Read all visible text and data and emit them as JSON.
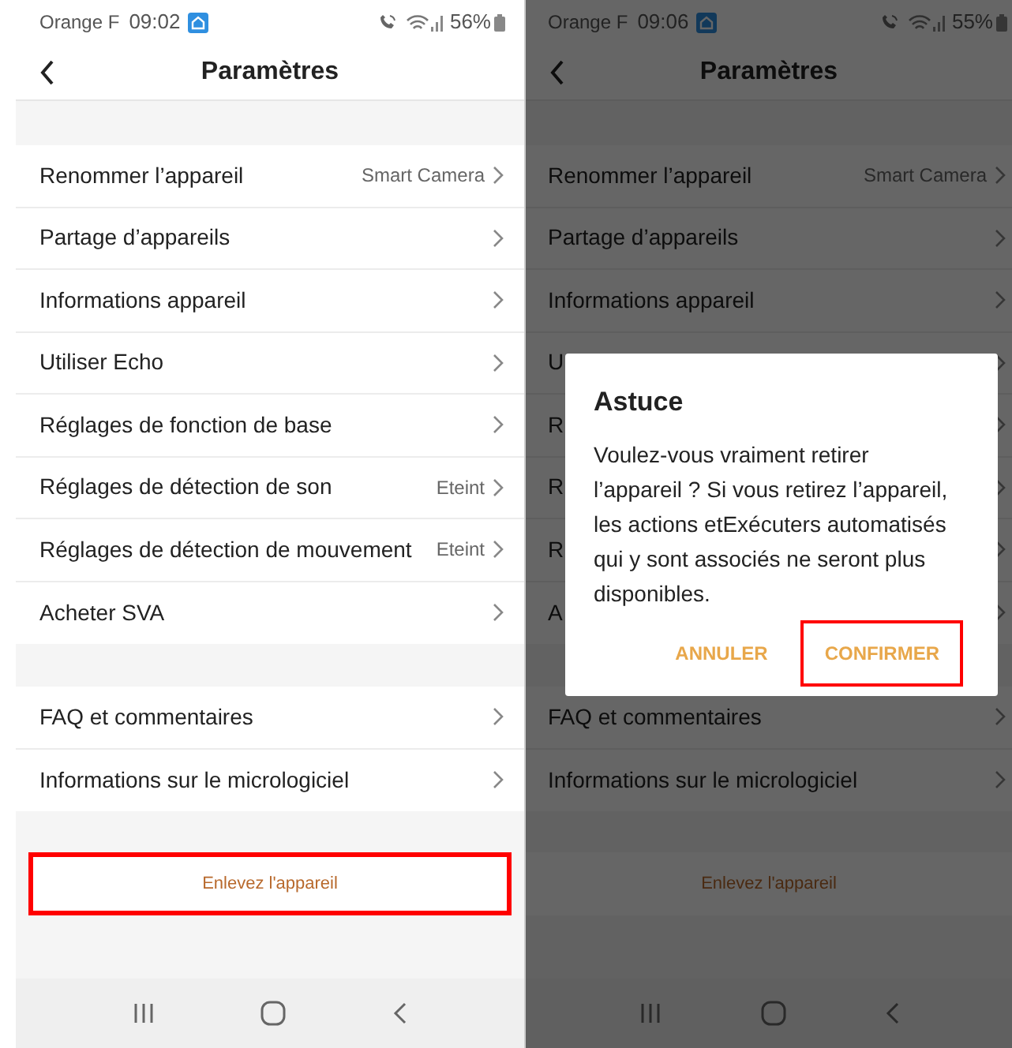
{
  "screens": [
    {
      "status_bar": {
        "carrier": "Orange F",
        "time": "09:02",
        "battery": "56%"
      },
      "header": {
        "title": "Paramètres"
      },
      "sections": [
        [
          {
            "label": "Renommer l’appareil",
            "value": "Smart Camera"
          },
          {
            "label": "Partage d’appareils"
          },
          {
            "label": "Informations appareil"
          },
          {
            "label": "Utiliser Echo"
          },
          {
            "label": "Réglages de fonction de base"
          },
          {
            "label": "Réglages de détection de son",
            "value": "Eteint"
          },
          {
            "label": "Réglages de détection de mouvement",
            "value": "Eteint"
          },
          {
            "label": "Acheter SVA"
          }
        ],
        [
          {
            "label": "FAQ et commentaires"
          },
          {
            "label": "Informations sur le micrologiciel"
          }
        ]
      ],
      "remove_button": {
        "label": "Enlevez l'appareil",
        "highlighted": true
      }
    },
    {
      "status_bar": {
        "carrier": "Orange F",
        "time": "09:06",
        "battery": "55%"
      },
      "header": {
        "title": "Paramètres"
      },
      "sections": [
        [
          {
            "label": "Renommer l’appareil",
            "value": "Smart Camera"
          },
          {
            "label": "Partage d’appareils"
          },
          {
            "label": "Informations appareil"
          },
          {
            "label": "U"
          },
          {
            "label": "R"
          },
          {
            "label": "R"
          },
          {
            "label": "R"
          },
          {
            "label": "A"
          }
        ],
        [
          {
            "label": "FAQ et commentaires"
          },
          {
            "label": "Informations sur le micrologiciel"
          }
        ]
      ],
      "remove_button": {
        "label": "Enlevez l'appareil",
        "highlighted": false
      },
      "dialog": {
        "title": "Astuce",
        "message": "Voulez-vous vraiment retirer l’appareil ? Si vous retirez l’appareil, les actions etExécuters automatisés qui y sont associés ne seront plus disponibles.",
        "buttons": [
          {
            "label": "ANNULER",
            "highlighted": false
          },
          {
            "label": "CONFIRMER",
            "highlighted": true
          }
        ]
      }
    }
  ]
}
